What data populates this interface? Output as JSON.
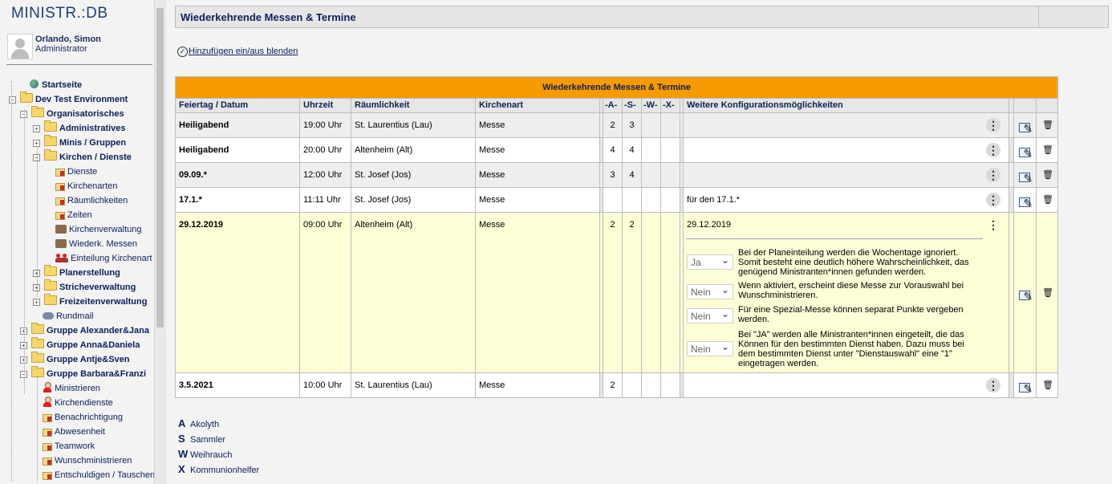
{
  "sidebar": {
    "logo": "MINISTR.:DB",
    "user": {
      "name": "Orlando, Simon",
      "role": "Administrator"
    },
    "items": [
      {
        "label": "Startseite",
        "icon": "globe-icon",
        "level": 1,
        "bold": true
      },
      {
        "label": "Dev Test Environment",
        "icon": "folder-icon",
        "level": 0,
        "bold": true,
        "toggle": "-"
      },
      {
        "label": "Organisatorisches",
        "icon": "folder-icon",
        "level": 1,
        "bold": true,
        "toggle": "-"
      },
      {
        "label": "Administratives",
        "icon": "folder-icon",
        "level": 2,
        "bold": true,
        "toggle": "+"
      },
      {
        "label": "Minis / Gruppen",
        "icon": "folder-icon",
        "level": 2,
        "bold": true,
        "toggle": "+"
      },
      {
        "label": "Kirchen / Dienste",
        "icon": "folder-icon",
        "level": 2,
        "bold": true,
        "toggle": "-"
      },
      {
        "label": "Dienste",
        "icon": "page-icon",
        "level": 3,
        "bold": false
      },
      {
        "label": "Kirchenarten",
        "icon": "page-icon",
        "level": 3,
        "bold": false
      },
      {
        "label": "Räumlichkeiten",
        "icon": "page-icon",
        "level": 3,
        "bold": false
      },
      {
        "label": "Zeiten",
        "icon": "page-icon",
        "level": 3,
        "bold": false
      },
      {
        "label": "Kirchenverwaltung",
        "icon": "church-icon",
        "level": 3,
        "bold": false
      },
      {
        "label": "Wiederk. Messen",
        "icon": "church-icon",
        "level": 3,
        "bold": false
      },
      {
        "label": "Einteilung Kirchenart",
        "icon": "group-icon",
        "level": 3,
        "bold": false
      },
      {
        "label": "Planerstellung",
        "icon": "folder-icon",
        "level": 2,
        "bold": true,
        "toggle": "+"
      },
      {
        "label": "Stricheverwaltung",
        "icon": "folder-icon",
        "level": 2,
        "bold": true,
        "toggle": "+"
      },
      {
        "label": "Freizeitenverwaltung",
        "icon": "folder-icon",
        "level": 2,
        "bold": true,
        "toggle": "+"
      },
      {
        "label": "Rundmail",
        "icon": "mail-icon",
        "level": 2,
        "bold": false
      },
      {
        "label": "Gruppe Alexander&Jana",
        "icon": "folder-icon",
        "level": 1,
        "bold": true,
        "toggle": "+"
      },
      {
        "label": "Gruppe Anna&Daniela",
        "icon": "folder-icon",
        "level": 1,
        "bold": true,
        "toggle": "+"
      },
      {
        "label": "Gruppe Antje&Sven",
        "icon": "folder-icon",
        "level": 1,
        "bold": true,
        "toggle": "+"
      },
      {
        "label": "Gruppe Barbara&Franzi",
        "icon": "folder-icon",
        "level": 1,
        "bold": true,
        "toggle": "-"
      },
      {
        "label": "Ministrieren",
        "icon": "person-icon",
        "level": 2,
        "bold": false
      },
      {
        "label": "Kirchendienste",
        "icon": "person-icon",
        "level": 2,
        "bold": false
      },
      {
        "label": "Benachrichtigung",
        "icon": "page-icon",
        "level": 2,
        "bold": false
      },
      {
        "label": "Abwesenheit",
        "icon": "page-icon",
        "level": 2,
        "bold": false
      },
      {
        "label": "Teamwork",
        "icon": "page-icon",
        "level": 2,
        "bold": false
      },
      {
        "label": "Wunschministrieren",
        "icon": "page-icon",
        "level": 2,
        "bold": false
      },
      {
        "label": "Entschuldigen / Tauschen",
        "icon": "page-icon",
        "level": 2,
        "bold": false
      }
    ]
  },
  "page": {
    "title": "Wiederkehrende Messen & Termine",
    "toggle_link": "Hinzufügen ein/aus blenden"
  },
  "table": {
    "banner": "Wiederkehrende Messen & Termine",
    "headers": [
      "Feiertag / Datum",
      "Uhrzeit",
      "Räumlichkeit",
      "Kirchenart",
      "-A-",
      "-S-",
      "-W-",
      "-X-",
      "Weitere Konfigurationsmöglichkeiten"
    ],
    "rows": [
      {
        "date": "Heiligabend",
        "time": "19:00 Uhr",
        "room": "St. Laurentius (Lau)",
        "kind": "Messe",
        "a": "2",
        "s": "3",
        "w": "",
        "x": "",
        "config": ""
      },
      {
        "date": "Heiligabend",
        "time": "20:00 Uhr",
        "room": "Altenheim (Alt)",
        "kind": "Messe",
        "a": "4",
        "s": "4",
        "w": "",
        "x": "",
        "config": ""
      },
      {
        "date": "09.09.*",
        "time": "12:00 Uhr",
        "room": "St. Josef (Jos)",
        "kind": "Messe",
        "a": "3",
        "s": "4",
        "w": "",
        "x": "",
        "config": ""
      },
      {
        "date": "17.1.*",
        "time": "11:11 Uhr",
        "room": "St. Josef (Jos)",
        "kind": "Messe",
        "a": "",
        "s": "",
        "w": "",
        "x": "",
        "config": "für den 17.1.*"
      },
      {
        "date": "29.12.2019",
        "time": "09:00 Uhr",
        "room": "Altenheim (Alt)",
        "kind": "Messe",
        "a": "2",
        "s": "2",
        "w": "",
        "x": "",
        "config": "29.12.2019"
      },
      {
        "date": "3.5.2021",
        "time": "10:00 Uhr",
        "room": "St. Laurentius (Lau)",
        "kind": "Messe",
        "a": "2",
        "s": "",
        "w": "",
        "x": "",
        "config": ""
      }
    ],
    "expanded_options": [
      {
        "value": "Ja",
        "text": "Bei der Planeinteilung werden die Wochentage ignoriert. Somit besteht eine deutlich höhere Wahrscheinlichkeit, das genügend Ministranten*innen gefunden werden."
      },
      {
        "value": "Nein",
        "text": "Wenn aktiviert, erscheint diese Messe zur Vorauswahl bei Wunschministrieren."
      },
      {
        "value": "Nein",
        "text": "Für eine Spezial-Messe können separat Punkte vergeben werden."
      },
      {
        "value": "Nein",
        "text": "Bei \"JA\" werden alle Ministranten*innen eingeteilt, die das Können für den bestimmten Dienst haben. Dazu muss bei dem bestimmten Dienst unter \"Dienstauswahl\" eine \"1\" eingetragen werden."
      }
    ]
  },
  "legend": [
    {
      "key": "A",
      "label": "Akolyth"
    },
    {
      "key": "S",
      "label": "Sammler"
    },
    {
      "key": "W",
      "label": "Weihrauch"
    },
    {
      "key": "X",
      "label": "Kommunionhelfer"
    }
  ],
  "colors": {
    "banner": "#f79a00",
    "selected_row": "#fdfdd6",
    "navy": "#0b1f5e"
  }
}
